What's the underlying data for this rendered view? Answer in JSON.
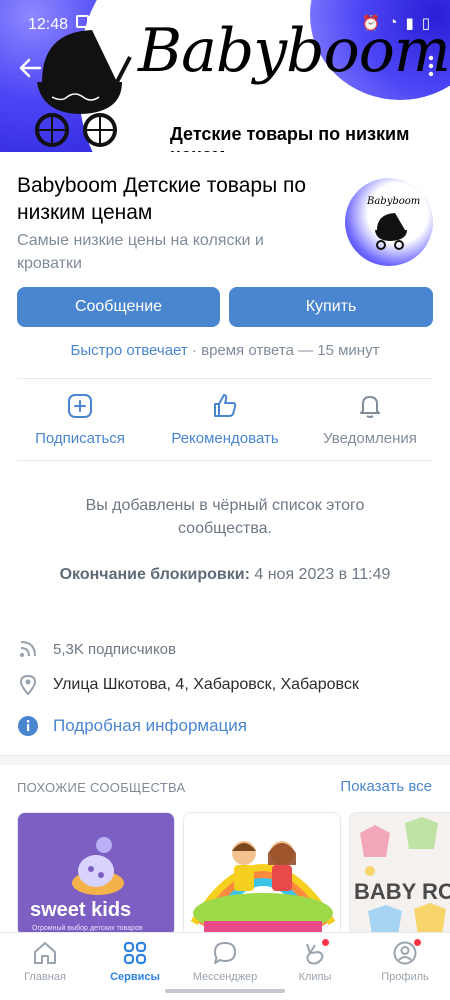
{
  "status_bar": {
    "time": "12:48"
  },
  "cover": {
    "brand_text": "Babyboom",
    "tagline": "Детские товары по  низким ценам"
  },
  "community": {
    "title": "Babyboom  Детские товары по  низким ценам",
    "subtitle": "Самые низкие цены на коляски и кроватки",
    "avatar_text": "Babyboom"
  },
  "buttons": {
    "message": "Сообщение",
    "buy": "Купить"
  },
  "reply": {
    "fast": "Быстро отвечает",
    "rest": " · время ответа — 15 минут"
  },
  "actions": [
    {
      "label": "Подписаться",
      "icon": "plus-square-icon"
    },
    {
      "label": "Рекомендовать",
      "icon": "thumb-up-icon"
    },
    {
      "label": "Уведомления",
      "icon": "bell-icon"
    }
  ],
  "block": {
    "message": "Вы добавлены в чёрный список этого сообщества.",
    "end_label": "Окончание блокировки:",
    "end_value": " 4 ноя 2023 в 11:49"
  },
  "info": {
    "subscribers": "5,3K подписчиков",
    "address": "Улица Шкотова, 4, Хабаровск, Хабаровск",
    "details": "Подробная информация"
  },
  "similar": {
    "heading": "ПОХОЖИЕ СООБЩЕСТВА",
    "show_all": "Показать все",
    "cards": [
      {
        "title": "sweet kids",
        "subtitle": "Огромный выбор детских товаров"
      },
      {
        "title": ""
      },
      {
        "title": "BABY RO"
      }
    ]
  },
  "nav": [
    {
      "label": "Главная",
      "icon": "home-icon",
      "active": false
    },
    {
      "label": "Сервисы",
      "icon": "services-icon",
      "active": true
    },
    {
      "label": "Мессенджер",
      "icon": "messenger-icon",
      "active": false
    },
    {
      "label": "Клипы",
      "icon": "clips-icon",
      "active": false
    },
    {
      "label": "Профиль",
      "icon": "profile-icon",
      "active": false
    }
  ],
  "colors": {
    "accent": "#4a86d0",
    "active_nav": "#2d81e0",
    "secondary_text": "#818c99",
    "notification_dot": "#ff3347"
  }
}
